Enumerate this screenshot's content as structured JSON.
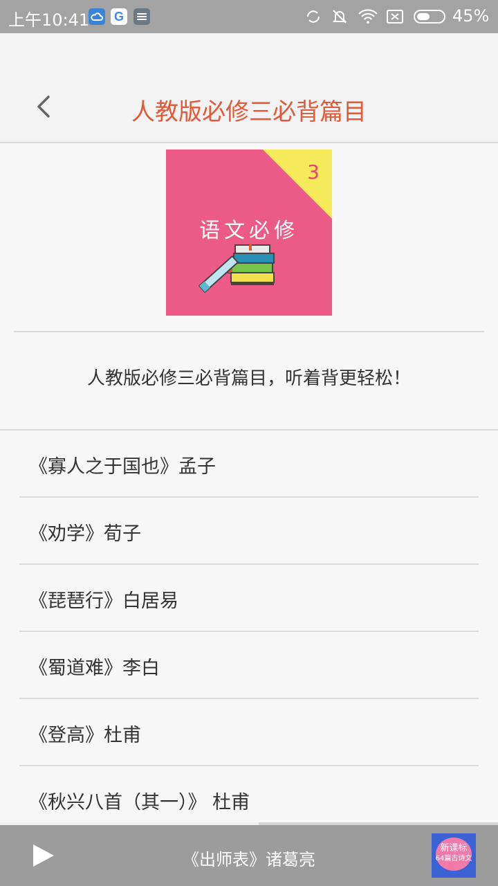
{
  "status_bar": {
    "time": "上午10:41",
    "battery": "45%",
    "icons": [
      "cloud-icon",
      "google-icon",
      "notes-icon",
      "sync-icon",
      "mute-icon",
      "wifi-icon",
      "no-sim-icon",
      "battery-icon"
    ]
  },
  "header": {
    "back_icon": "chevron-left-icon",
    "title": "人教版必修三必背篇目"
  },
  "cover": {
    "label": "语文必修",
    "number": "3"
  },
  "subtitle": "人教版必修三必背篇目，听着背更轻松！",
  "list": {
    "items": [
      {
        "title": "《寡人之于国也》孟子"
      },
      {
        "title": "《劝学》荀子"
      },
      {
        "title": "《琵琶行》白居易"
      },
      {
        "title": "《蜀道难》李白"
      },
      {
        "title": "《登高》杜甫"
      },
      {
        "title": "《秋兴八首（其一）》 杜甫"
      }
    ]
  },
  "player": {
    "now_playing": "《出师表》诸葛亮",
    "progress": 0.52,
    "thumb_text_1": "新课标",
    "thumb_text_2": "64篇古诗文",
    "colors": {
      "bar": "#9c9c9c",
      "title_accent": "#e05a3a",
      "cover_bg": "#ec5b87"
    }
  }
}
